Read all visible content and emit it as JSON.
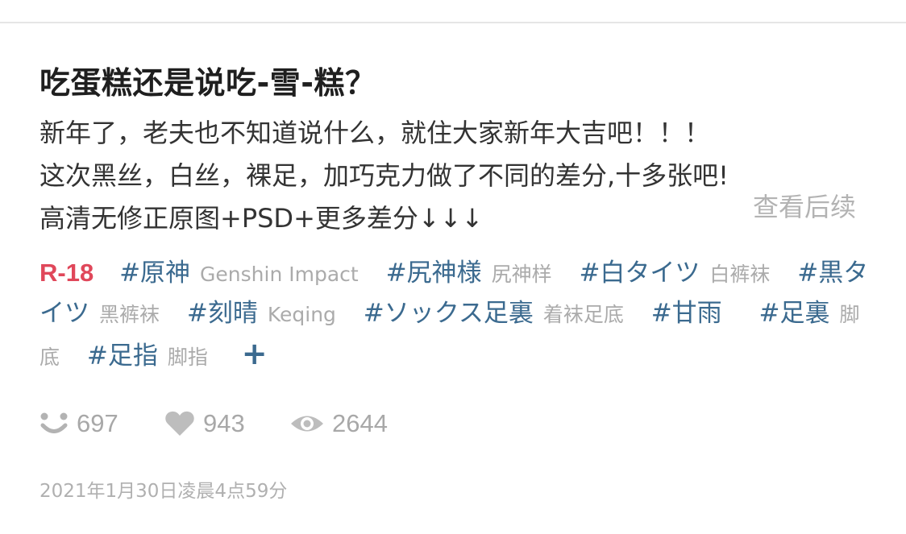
{
  "post": {
    "title": "吃蛋糕还是说吃-雪-糕？",
    "description": [
      "新年了，老夫也不知道说什么，就住大家新年大吉吧！！！",
      "这次黑丝，白丝，裸足，加巧克力做了不同的差分,十多张吧!",
      "高清无修正原图+PSD+更多差分↓↓↓"
    ],
    "read_more": "查看后续",
    "rating_badge": "R-18",
    "tags": [
      {
        "tag": "#原神",
        "translation": "Genshin Impact"
      },
      {
        "tag": "#尻神様",
        "translation": "尻神样"
      },
      {
        "tag": "#白タイツ",
        "translation": "白裤袜"
      },
      {
        "tag": "#黒タイツ",
        "translation": "黑裤袜"
      },
      {
        "tag": "#刻晴",
        "translation": "Keqing"
      },
      {
        "tag": "#ソックス足裏",
        "translation": "着袜足底"
      },
      {
        "tag": "#甘雨",
        "translation": ""
      },
      {
        "tag": "#足裏",
        "translation": "脚底"
      },
      {
        "tag": "#足指",
        "translation": "脚指"
      }
    ],
    "add_tag_label": "+",
    "stats": {
      "comments": "697",
      "likes": "943",
      "views": "2644"
    },
    "icons": {
      "comments": "smiley-face-icon",
      "likes": "heart-icon",
      "views": "eye-icon"
    },
    "datetime": "2021年1月30日凌晨4点59分"
  },
  "colors": {
    "rating": "#e0475a",
    "tag": "#3b6a8f",
    "muted": "#ababab"
  }
}
